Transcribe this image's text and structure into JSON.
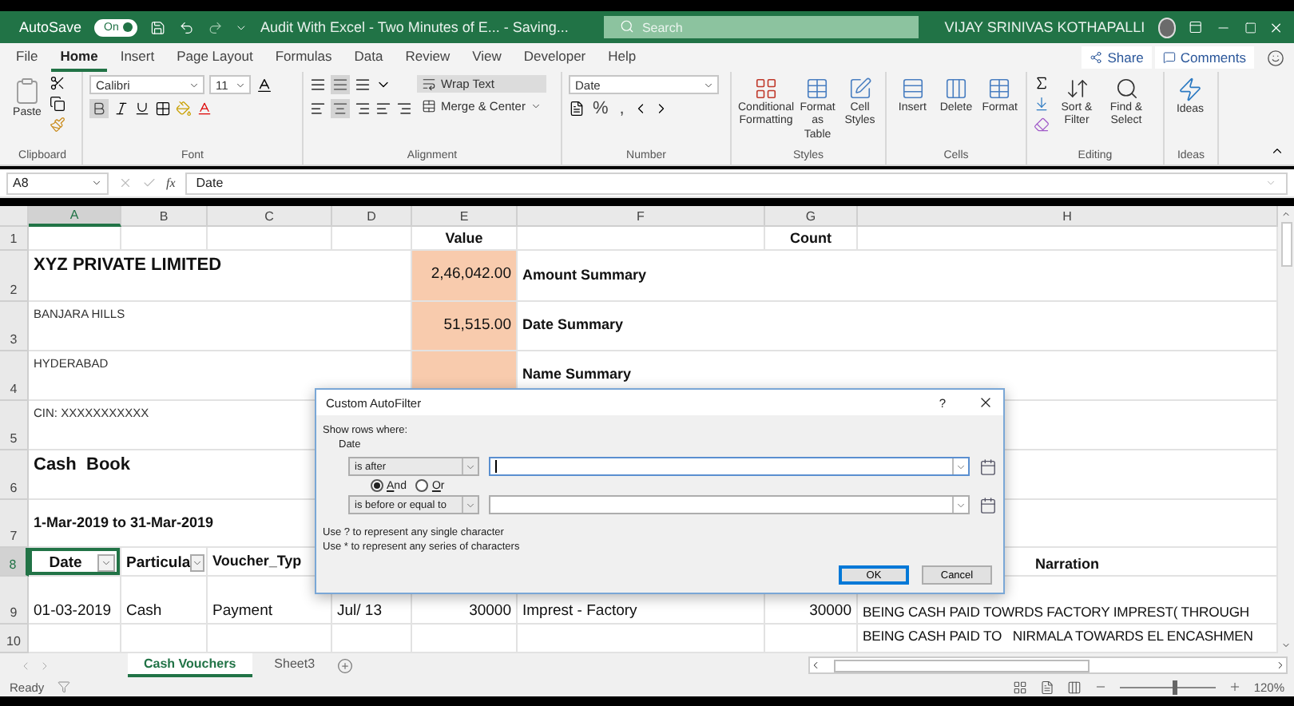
{
  "title_bar": {
    "autosave_label": "AutoSave",
    "autosave_on": true,
    "autosave_state": "On",
    "document_title": "Audit With Excel - Two Minutes of E... - Saving...",
    "search_placeholder": "Search",
    "user_name": "VIJAY SRINIVAS KOTHAPALLI"
  },
  "ribbon_tabs": [
    {
      "label": "File",
      "selected": false
    },
    {
      "label": "Home",
      "selected": true
    },
    {
      "label": "Insert",
      "selected": false
    },
    {
      "label": "Page Layout",
      "selected": false
    },
    {
      "label": "Formulas",
      "selected": false
    },
    {
      "label": "Data",
      "selected": false
    },
    {
      "label": "Review",
      "selected": false
    },
    {
      "label": "View",
      "selected": false
    },
    {
      "label": "Developer",
      "selected": false
    },
    {
      "label": "Help",
      "selected": false
    }
  ],
  "ribbon_actions": [
    "Share",
    "Comments"
  ],
  "ribbon": {
    "clipboard": {
      "label": "Clipboard",
      "paste": "Paste"
    },
    "font": {
      "label": "Font",
      "name": "Calibri",
      "size": "11"
    },
    "alignment": {
      "label": "Alignment",
      "wrap_text": "Wrap Text",
      "merge": "Merge & Center"
    },
    "number": {
      "label": "Number",
      "format": "Date",
      "percent": "%",
      "comma": ","
    },
    "styles": {
      "label": "Styles",
      "buttons": [
        "Conditional Formatting",
        "Format as Table",
        "Cell Styles"
      ]
    },
    "cells": {
      "label": "Cells",
      "buttons": [
        "Insert",
        "Delete",
        "Format"
      ]
    },
    "editing": {
      "label": "Editing",
      "buttons": [
        "Sort & Filter",
        "Find & Select"
      ]
    },
    "ideas": {
      "label": "Ideas",
      "button": "Ideas"
    }
  },
  "formula_bar": {
    "name_box": "A8",
    "function_label": "fx",
    "formula": "Date"
  },
  "sheet": {
    "columns": [
      "A",
      "B",
      "C",
      "D",
      "E",
      "F",
      "G",
      "H"
    ],
    "rows": [
      {
        "number": "1",
        "cells": [
          {
            "text": ""
          },
          {
            "text": ""
          },
          {
            "text": ""
          },
          {
            "text": ""
          },
          {
            "text": "Value",
            "kind": "heading",
            "shaded": false,
            "selected": false
          },
          {
            "text": ""
          },
          {
            "text": "Count",
            "kind": "heading",
            "shaded": false,
            "selected": false
          },
          {
            "text": ""
          }
        ]
      },
      {
        "number": "2",
        "cells": [
          {
            "text": "XYZ PRIVATE LIMITED",
            "kind": "title",
            "shaded": false,
            "selected": false
          },
          {
            "text": ""
          },
          {
            "text": ""
          },
          {
            "text": ""
          },
          {
            "text": "2,46,042.00",
            "kind": "number",
            "shaded": true,
            "selected": false
          },
          {
            "text": "Amount Summary",
            "kind": "bold",
            "shaded": false,
            "selected": false
          },
          {
            "text": ""
          },
          {
            "text": ""
          }
        ]
      },
      {
        "number": "3",
        "cells": [
          {
            "text": "BANJARA HILLS",
            "kind": "small",
            "shaded": false,
            "selected": false
          },
          {
            "text": ""
          },
          {
            "text": ""
          },
          {
            "text": ""
          },
          {
            "text": "51,515.00",
            "kind": "number",
            "shaded": true,
            "selected": false
          },
          {
            "text": "Date Summary",
            "kind": "bold",
            "shaded": false,
            "selected": false
          },
          {
            "text": ""
          },
          {
            "text": ""
          }
        ]
      },
      {
        "number": "4",
        "cells": [
          {
            "text": "HYDERABAD",
            "kind": "small",
            "shaded": false,
            "selected": false
          },
          {
            "text": ""
          },
          {
            "text": ""
          },
          {
            "text": ""
          },
          {
            "text": "",
            "kind": "number",
            "shaded": true,
            "selected": false
          },
          {
            "text": "Name Summary",
            "kind": "bold",
            "shaded": false,
            "selected": false
          },
          {
            "text": ""
          },
          {
            "text": ""
          }
        ]
      },
      {
        "number": "5",
        "cells": [
          {
            "text": "CIN: XXXXXXXXXXX",
            "kind": "small",
            "shaded": false,
            "selected": false
          }
        ]
      },
      {
        "number": "6",
        "cells": [
          {
            "text": "Cash  Book",
            "kind": "title",
            "shaded": false,
            "selected": false
          }
        ]
      },
      {
        "number": "7",
        "cells": [
          {
            "text": "1-Mar-2019 to 31-Mar-2019",
            "kind": "bold",
            "shaded": false,
            "selected": false
          }
        ]
      },
      {
        "number": "8",
        "cells": [
          {
            "text": "Date",
            "kind": "filter",
            "shaded": false,
            "selected": true
          },
          {
            "text": "Particula",
            "kind": "filter",
            "shaded": false,
            "selected": false
          },
          {
            "text": "Voucher_Typ",
            "kind": "bold",
            "shaded": false,
            "selected": false
          },
          {
            "text": ""
          },
          {
            "text": ""
          },
          {
            "text": ""
          },
          {
            "text": ""
          },
          {
            "text": "Narration",
            "kind": "heading",
            "shaded": false,
            "selected": false
          }
        ]
      },
      {
        "number": "9",
        "cells": [
          {
            "text": "01-03-2019",
            "kind": "data",
            "shaded": false,
            "selected": false
          },
          {
            "text": "Cash",
            "kind": "data",
            "shaded": false,
            "selected": false
          },
          {
            "text": "Payment",
            "kind": "data",
            "shaded": false,
            "selected": false
          },
          {
            "text": "Jul/ 13",
            "kind": "data",
            "shaded": false,
            "selected": false
          },
          {
            "text": "30000",
            "kind": "amount",
            "shaded": false,
            "selected": false
          },
          {
            "text": "Imprest - Factory",
            "kind": "data",
            "shaded": false,
            "selected": false
          },
          {
            "text": "30000",
            "kind": "amount",
            "shaded": false,
            "selected": false
          },
          {
            "text": "BEING CASH PAID TOWRDS FACTORY IMPREST( THROUGH",
            "kind": "narration",
            "shaded": false,
            "selected": false
          }
        ]
      },
      {
        "number": "10",
        "cells": [
          {
            "text": ""
          },
          {
            "text": ""
          },
          {
            "text": ""
          },
          {
            "text": ""
          },
          {
            "text": ""
          },
          {
            "text": ""
          },
          {
            "text": ""
          },
          {
            "text": "BEING CASH PAID TO   NIRMALA TOWARDS EL ENCASHMEN",
            "kind": "top",
            "shaded": false,
            "selected": false
          }
        ]
      }
    ]
  },
  "dialog": {
    "title": "Custom AutoFilter",
    "help": "?",
    "intro": "Show rows where:",
    "field": "Date",
    "conditions": [
      {
        "operator": "is after",
        "focused": true
      },
      {
        "operator": "is before or equal to",
        "focused": false
      }
    ],
    "join": [
      {
        "label": "And",
        "selected": true
      },
      {
        "label": "Or",
        "selected": false
      }
    ],
    "hints": [
      "Use ? to represent any single character",
      "Use * to represent any series of characters"
    ],
    "buttons": [
      {
        "label": "OK",
        "default": true
      },
      {
        "label": "Cancel",
        "default": false
      }
    ]
  },
  "sheet_tabs": [
    {
      "label": "Cash Vouchers",
      "selected": true
    },
    {
      "label": "Sheet3",
      "selected": false
    }
  ],
  "status_bar": {
    "status": "Ready",
    "zoom_slider": {
      "level": 0.55
    },
    "zoom": "120%"
  }
}
